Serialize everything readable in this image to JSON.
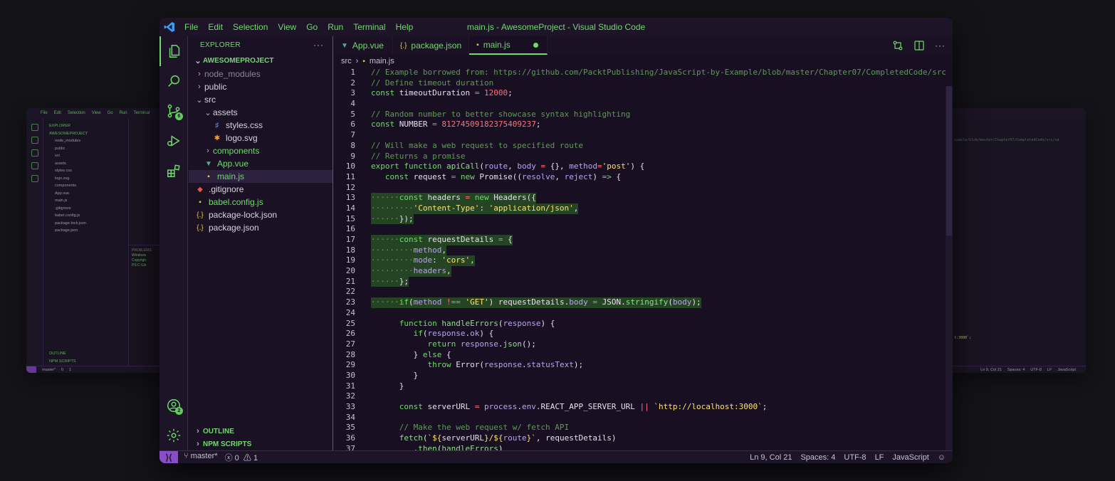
{
  "window": {
    "title": "main.js - AwesomeProject - Visual Studio Code"
  },
  "menu": [
    "File",
    "Edit",
    "Selection",
    "View",
    "Go",
    "Run",
    "Terminal",
    "Help"
  ],
  "activity": {
    "scm_badge": "6",
    "accounts_badge": "2"
  },
  "sidebar": {
    "header": "EXPLORER",
    "root": "AWESOMEPROJECT",
    "tree": [
      {
        "label": "node_modules",
        "depth": 0,
        "type": "folder",
        "open": false,
        "dim": true
      },
      {
        "label": "public",
        "depth": 0,
        "type": "folder",
        "open": false
      },
      {
        "label": "src",
        "depth": 0,
        "type": "folder",
        "open": true
      },
      {
        "label": "assets",
        "depth": 1,
        "type": "folder",
        "open": true
      },
      {
        "label": "styles.css",
        "depth": 2,
        "type": "css"
      },
      {
        "label": "logo.svg",
        "depth": 2,
        "type": "svg"
      },
      {
        "label": "components",
        "depth": 1,
        "type": "folder",
        "open": false,
        "green": true
      },
      {
        "label": "App.vue",
        "depth": 1,
        "type": "vue",
        "green": true
      },
      {
        "label": "main.js",
        "depth": 1,
        "type": "js",
        "selected": true,
        "green": true
      },
      {
        "label": ".gitignore",
        "depth": 0,
        "type": "git"
      },
      {
        "label": "babel.config.js",
        "depth": 0,
        "type": "js",
        "green": true
      },
      {
        "label": "package-lock.json",
        "depth": 0,
        "type": "json"
      },
      {
        "label": "package.json",
        "depth": 0,
        "type": "json"
      }
    ],
    "outline": "OUTLINE",
    "npm_scripts": "NPM SCRIPTS"
  },
  "tabs": [
    {
      "label": "App.vue",
      "icon": "vue",
      "active": false
    },
    {
      "label": "package.json",
      "icon": "json",
      "active": false
    },
    {
      "label": "main.js",
      "icon": "js",
      "active": true,
      "modified": true
    }
  ],
  "breadcrumb": [
    "src",
    "main.js"
  ],
  "code_lines": [
    {
      "n": "1",
      "hl": false,
      "tokens": [
        [
          "c-com",
          "// Example borrowed from: https://github.com/PacktPublishing/JavaScript-by-Example/blob/master/Chapter07/CompletedCode/src/se"
        ]
      ]
    },
    {
      "n": "2",
      "hl": false,
      "tokens": [
        [
          "c-com",
          "// Define timeout duration"
        ]
      ]
    },
    {
      "n": "3",
      "hl": false,
      "tokens": [
        [
          "c-kw",
          "const "
        ],
        [
          "",
          "timeoutDuration "
        ],
        [
          "c-op",
          "= "
        ],
        [
          "c-num",
          "12000"
        ],
        [
          "",
          ";"
        ]
      ]
    },
    {
      "n": "4",
      "hl": false,
      "tokens": []
    },
    {
      "n": "5",
      "hl": false,
      "tokens": [
        [
          "c-com",
          "// Random number to better showcase syntax highlighting"
        ]
      ]
    },
    {
      "n": "6",
      "hl": false,
      "tokens": [
        [
          "c-kw",
          "const "
        ],
        [
          "",
          "NUMBER "
        ],
        [
          "c-op",
          "= "
        ],
        [
          "c-num",
          "81274509182375409237"
        ],
        [
          "",
          ";"
        ]
      ]
    },
    {
      "n": "7",
      "hl": false,
      "tokens": []
    },
    {
      "n": "8",
      "hl": false,
      "tokens": [
        [
          "c-com",
          "// Will make a web request to specified route"
        ]
      ]
    },
    {
      "n": "9",
      "hl": false,
      "tokens": [
        [
          "c-com",
          "// Returns a promise"
        ]
      ]
    },
    {
      "n": "10",
      "hl": false,
      "tokens": [
        [
          "c-kw",
          "export function "
        ],
        [
          "c-fn",
          "apiCall"
        ],
        [
          "",
          "("
        ],
        [
          "c-var",
          "route"
        ],
        [
          "",
          ", "
        ],
        [
          "c-var",
          "body "
        ],
        [
          "c-op",
          "= "
        ],
        [
          "",
          "{}, "
        ],
        [
          "c-var",
          "method"
        ],
        [
          "c-op",
          "="
        ],
        [
          "c-str",
          "'post'"
        ],
        [
          "",
          ") {"
        ]
      ]
    },
    {
      "n": "11",
      "hl": false,
      "tokens": [
        [
          "",
          "   "
        ],
        [
          "c-kw",
          "const "
        ],
        [
          "",
          "request "
        ],
        [
          "c-op",
          "= "
        ],
        [
          "c-kw",
          "new "
        ],
        [
          "",
          "Promise(("
        ],
        [
          "c-var",
          "resolve"
        ],
        [
          "",
          ", "
        ],
        [
          "c-var",
          "reject"
        ],
        [
          "",
          ") "
        ],
        [
          "c-kw",
          "=> "
        ],
        [
          "",
          "{"
        ]
      ]
    },
    {
      "n": "12",
      "hl": false,
      "tokens": []
    },
    {
      "n": "13",
      "hl": true,
      "tokens": [
        [
          "c-com",
          "······"
        ],
        [
          "c-kw",
          "const "
        ],
        [
          "",
          "headers "
        ],
        [
          "c-op",
          "= "
        ],
        [
          "c-kw",
          "new "
        ],
        [
          "",
          "Headers({"
        ]
      ]
    },
    {
      "n": "14",
      "hl": true,
      "tokens": [
        [
          "c-com",
          "·········"
        ],
        [
          "c-str",
          "'Content-Type'"
        ],
        [
          "",
          ": "
        ],
        [
          "c-str",
          "'application/json'"
        ],
        [
          "",
          ","
        ]
      ]
    },
    {
      "n": "15",
      "hl": true,
      "tokens": [
        [
          "c-com",
          "······"
        ],
        [
          "",
          "});"
        ]
      ]
    },
    {
      "n": "16",
      "hl": false,
      "tokens": []
    },
    {
      "n": "17",
      "hl": true,
      "tokens": [
        [
          "c-com",
          "······"
        ],
        [
          "c-kw",
          "const "
        ],
        [
          "",
          "requestDetails "
        ],
        [
          "c-op",
          "= "
        ],
        [
          "",
          "{"
        ]
      ]
    },
    {
      "n": "18",
      "hl": true,
      "tokens": [
        [
          "c-com",
          "·········"
        ],
        [
          "c-var",
          "method"
        ],
        [
          "",
          ","
        ]
      ]
    },
    {
      "n": "19",
      "hl": true,
      "tokens": [
        [
          "c-com",
          "·········"
        ],
        [
          "c-var",
          "mode"
        ],
        [
          "",
          ": "
        ],
        [
          "c-str",
          "'cors'"
        ],
        [
          "",
          ","
        ]
      ]
    },
    {
      "n": "20",
      "hl": true,
      "tokens": [
        [
          "c-com",
          "·········"
        ],
        [
          "c-var",
          "headers"
        ],
        [
          "",
          ","
        ]
      ]
    },
    {
      "n": "21",
      "hl": true,
      "tokens": [
        [
          "c-com",
          "······"
        ],
        [
          "",
          "};"
        ]
      ]
    },
    {
      "n": "22",
      "hl": false,
      "tokens": []
    },
    {
      "n": "23",
      "hl": true,
      "tokens": [
        [
          "c-com",
          "······"
        ],
        [
          "c-kw",
          "if"
        ],
        [
          "",
          "("
        ],
        [
          "c-var",
          "method "
        ],
        [
          "c-op",
          "!== "
        ],
        [
          "c-str",
          "'GET'"
        ],
        [
          "",
          ") requestDetails."
        ],
        [
          "c-var",
          "body "
        ],
        [
          "c-op",
          "= "
        ],
        [
          "",
          "JSON."
        ],
        [
          "c-fn",
          "stringify"
        ],
        [
          "",
          "("
        ],
        [
          "c-var",
          "body"
        ],
        [
          "",
          ");"
        ]
      ]
    },
    {
      "n": "24",
      "hl": false,
      "tokens": []
    },
    {
      "n": "25",
      "hl": false,
      "tokens": [
        [
          "",
          "      "
        ],
        [
          "c-kw",
          "function "
        ],
        [
          "c-fn",
          "handleErrors"
        ],
        [
          "",
          "("
        ],
        [
          "c-var",
          "response"
        ],
        [
          "",
          ") {"
        ]
      ]
    },
    {
      "n": "26",
      "hl": false,
      "tokens": [
        [
          "",
          "         "
        ],
        [
          "c-kw",
          "if"
        ],
        [
          "",
          "("
        ],
        [
          "c-var",
          "response"
        ],
        [
          "",
          "."
        ],
        [
          "c-var",
          "ok"
        ],
        [
          "",
          ") {"
        ]
      ]
    },
    {
      "n": "27",
      "hl": false,
      "tokens": [
        [
          "",
          "            "
        ],
        [
          "c-kw",
          "return "
        ],
        [
          "c-var",
          "response"
        ],
        [
          "",
          "."
        ],
        [
          "c-fn",
          "json"
        ],
        [
          "",
          "();"
        ]
      ]
    },
    {
      "n": "28",
      "hl": false,
      "tokens": [
        [
          "",
          "         } "
        ],
        [
          "c-kw",
          "else "
        ],
        [
          "",
          "{"
        ]
      ]
    },
    {
      "n": "29",
      "hl": false,
      "tokens": [
        [
          "",
          "            "
        ],
        [
          "c-kw",
          "throw "
        ],
        [
          "",
          "Error("
        ],
        [
          "c-var",
          "response"
        ],
        [
          "",
          "."
        ],
        [
          "c-var",
          "statusText"
        ],
        [
          "",
          ");"
        ]
      ]
    },
    {
      "n": "30",
      "hl": false,
      "tokens": [
        [
          "",
          "         }"
        ]
      ]
    },
    {
      "n": "31",
      "hl": false,
      "tokens": [
        [
          "",
          "      }"
        ]
      ]
    },
    {
      "n": "32",
      "hl": false,
      "tokens": []
    },
    {
      "n": "33",
      "hl": false,
      "tokens": [
        [
          "",
          "      "
        ],
        [
          "c-kw",
          "const "
        ],
        [
          "",
          "serverURL "
        ],
        [
          "c-op",
          "= "
        ],
        [
          "c-var",
          "process"
        ],
        [
          "",
          "."
        ],
        [
          "c-var",
          "env"
        ],
        [
          "",
          ".REACT_APP_SERVER_URL "
        ],
        [
          "c-op",
          "|| "
        ],
        [
          "c-str",
          "`http://localhost:3000`"
        ],
        [
          "",
          ";"
        ]
      ]
    },
    {
      "n": "34",
      "hl": false,
      "tokens": []
    },
    {
      "n": "35",
      "hl": false,
      "tokens": [
        [
          "",
          "      "
        ],
        [
          "c-com",
          "// Make the web request w/ fetch API"
        ]
      ]
    },
    {
      "n": "36",
      "hl": false,
      "tokens": [
        [
          "",
          "      "
        ],
        [
          "c-fn",
          "fetch"
        ],
        [
          "",
          "("
        ],
        [
          "c-str",
          "`${"
        ],
        [
          "",
          "serverURL"
        ],
        [
          "c-str",
          "}/${"
        ],
        [
          "c-var",
          "route"
        ],
        [
          "c-str",
          "}`"
        ],
        [
          "",
          ", requestDetails)"
        ]
      ]
    },
    {
      "n": "37",
      "hl": false,
      "tokens": [
        [
          "",
          "         ."
        ],
        [
          "c-fn",
          "then"
        ],
        [
          "",
          "("
        ],
        [
          "c-fn",
          "handleErrors"
        ],
        [
          "",
          ")"
        ]
      ]
    }
  ],
  "status": {
    "branch": "master*",
    "errors": "0",
    "warnings": "1",
    "position": "Ln 9, Col 21",
    "spaces": "Spaces: 4",
    "encoding": "UTF-8",
    "eol": "LF",
    "language": "JavaScript"
  },
  "ghost_left": {
    "menu": [
      "File",
      "Edit",
      "Selection",
      "View",
      "Go",
      "Run",
      "Terminal"
    ],
    "header": "EXPLORER",
    "root": "AWESOMEPROJECT",
    "items": [
      "node_modules",
      "public",
      "src",
      "assets",
      "styles.css",
      "logo.svg",
      "components",
      "App.vue",
      "main.js",
      ".gitignore",
      "babel.config.js",
      "package-lock.json",
      "package.json"
    ],
    "outline": "OUTLINE",
    "npm": "NPM SCRIPTS",
    "panel_title": "PROBLEMS",
    "terminal_lines": [
      "Windows",
      "Copyrigh",
      "",
      "PS C:\\Us"
    ],
    "branch": "master*",
    "errors": "0",
    "warnings": "1"
  },
  "ghost_right": {
    "code_fragment": "xample/blob/master/Chapter07/CompletedCode/src/se",
    "code_fragment2": "t:3000`;",
    "status": [
      "Ln 9, Col 21",
      "Spaces: 4",
      "UTF-8",
      "LF",
      "JavaScript"
    ]
  },
  "colors": {
    "accent": "#6fdb6a",
    "background": "#190f22",
    "remote": "#8a4dc8",
    "highlight": "#254424"
  }
}
